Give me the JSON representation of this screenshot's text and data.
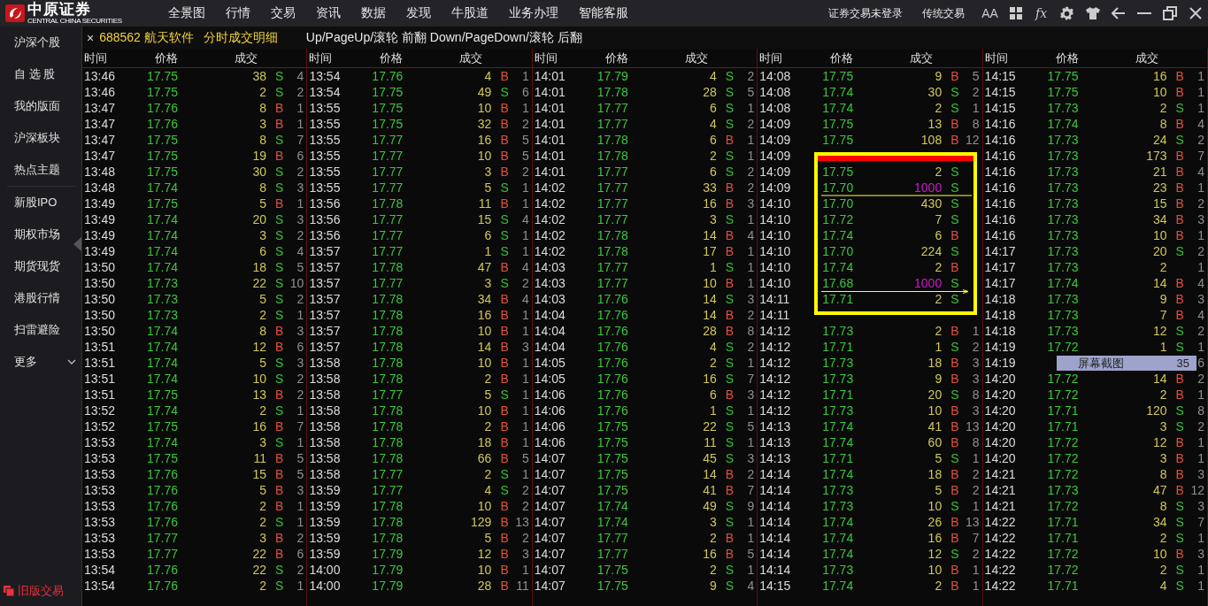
{
  "app": {
    "logo": "中原证券",
    "logo_subtitle": "CENTRAL CHINA SECURITIES",
    "menu": [
      "全景图",
      "行情",
      "交易",
      "资讯",
      "数据",
      "发现",
      "牛股道",
      "业务办理",
      "智能客服"
    ],
    "login_status": "证券交易未登录",
    "classic_trading": "传统交易",
    "font_button": "AA",
    "formula_button": "fx"
  },
  "tab": {
    "close": "×",
    "security": "688562 航天软件",
    "view": "分时成交明细",
    "hint": "Up/PageUp/滚轮 前翻 Down/PageDown/滚轮 后翻"
  },
  "sidebar": {
    "items": [
      "沪深个股",
      "自 选 股",
      "我的版面",
      "沪深板块",
      "热点主题",
      "新股IPO",
      "期权市场",
      "期货现货",
      "港股行情",
      "扫雷避险"
    ],
    "more": "更多",
    "footer": "旧版交易"
  },
  "trades": {
    "columns": [
      {
        "headers": [
          "时间",
          "价格",
          "成交"
        ],
        "rows": [
          {
            "time": "13:46",
            "price": "17.75",
            "volume": "38",
            "side": "S",
            "kind": "sell",
            "large": false,
            "count": "4"
          },
          {
            "time": "13:46",
            "price": "17.75",
            "volume": "2",
            "side": "S",
            "kind": "sell",
            "large": false,
            "count": "2"
          },
          {
            "time": "13:47",
            "price": "17.76",
            "volume": "8",
            "side": "B",
            "kind": "buy",
            "large": false,
            "count": "1"
          },
          {
            "time": "13:47",
            "price": "17.76",
            "volume": "3",
            "side": "B",
            "kind": "buy",
            "large": false,
            "count": "1"
          },
          {
            "time": "13:47",
            "price": "17.75",
            "volume": "8",
            "side": "S",
            "kind": "sell",
            "large": false,
            "count": "7"
          },
          {
            "time": "13:47",
            "price": "17.75",
            "volume": "19",
            "side": "B",
            "kind": "buy",
            "large": false,
            "count": "6"
          },
          {
            "time": "13:48",
            "price": "17.75",
            "volume": "30",
            "side": "S",
            "kind": "sell",
            "large": false,
            "count": "2"
          },
          {
            "time": "13:48",
            "price": "17.74",
            "volume": "8",
            "side": "S",
            "kind": "sell",
            "large": false,
            "count": "3"
          },
          {
            "time": "13:49",
            "price": "17.75",
            "volume": "5",
            "side": "B",
            "kind": "buy",
            "large": false,
            "count": "1"
          },
          {
            "time": "13:49",
            "price": "17.74",
            "volume": "20",
            "side": "S",
            "kind": "sell",
            "large": false,
            "count": "3"
          },
          {
            "time": "13:49",
            "price": "17.74",
            "volume": "3",
            "side": "S",
            "kind": "sell",
            "large": false,
            "count": "2"
          },
          {
            "time": "13:49",
            "price": "17.74",
            "volume": "6",
            "side": "S",
            "kind": "sell",
            "large": false,
            "count": "4"
          },
          {
            "time": "13:50",
            "price": "17.74",
            "volume": "18",
            "side": "S",
            "kind": "sell",
            "large": false,
            "count": "5"
          },
          {
            "time": "13:50",
            "price": "17.73",
            "volume": "22",
            "side": "S",
            "kind": "sell",
            "large": false,
            "count": "10"
          },
          {
            "time": "13:50",
            "price": "17.73",
            "volume": "5",
            "side": "S",
            "kind": "sell",
            "large": false,
            "count": "2"
          },
          {
            "time": "13:50",
            "price": "17.73",
            "volume": "2",
            "side": "S",
            "kind": "sell",
            "large": false,
            "count": "1"
          },
          {
            "time": "13:50",
            "price": "17.74",
            "volume": "8",
            "side": "B",
            "kind": "buy",
            "large": false,
            "count": "3"
          },
          {
            "time": "13:51",
            "price": "17.74",
            "volume": "12",
            "side": "B",
            "kind": "buy",
            "large": false,
            "count": "6"
          },
          {
            "time": "13:51",
            "price": "17.74",
            "volume": "5",
            "side": "S",
            "kind": "sell",
            "large": false,
            "count": "3"
          },
          {
            "time": "13:51",
            "price": "17.74",
            "volume": "10",
            "side": "S",
            "kind": "sell",
            "large": false,
            "count": "2"
          },
          {
            "time": "13:51",
            "price": "17.75",
            "volume": "13",
            "side": "B",
            "kind": "buy",
            "large": false,
            "count": "2"
          },
          {
            "time": "13:52",
            "price": "17.74",
            "volume": "2",
            "side": "S",
            "kind": "sell",
            "large": false,
            "count": "1"
          },
          {
            "time": "13:52",
            "price": "17.75",
            "volume": "16",
            "side": "B",
            "kind": "buy",
            "large": false,
            "count": "7"
          },
          {
            "time": "13:53",
            "price": "17.74",
            "volume": "3",
            "side": "S",
            "kind": "sell",
            "large": false,
            "count": "1"
          },
          {
            "time": "13:53",
            "price": "17.75",
            "volume": "11",
            "side": "B",
            "kind": "buy",
            "large": false,
            "count": "5"
          },
          {
            "time": "13:53",
            "price": "17.76",
            "volume": "15",
            "side": "B",
            "kind": "buy",
            "large": false,
            "count": "5"
          },
          {
            "time": "13:53",
            "price": "17.76",
            "volume": "5",
            "side": "B",
            "kind": "buy",
            "large": false,
            "count": "3"
          },
          {
            "time": "13:53",
            "price": "17.76",
            "volume": "2",
            "side": "B",
            "kind": "buy",
            "large": false,
            "count": "1"
          },
          {
            "time": "13:53",
            "price": "17.76",
            "volume": "2",
            "side": "S",
            "kind": "sell",
            "large": false,
            "count": "1"
          },
          {
            "time": "13:53",
            "price": "17.77",
            "volume": "3",
            "side": "B",
            "kind": "buy",
            "large": false,
            "count": "2"
          },
          {
            "time": "13:53",
            "price": "17.77",
            "volume": "22",
            "side": "B",
            "kind": "buy",
            "large": false,
            "count": "6"
          },
          {
            "time": "13:54",
            "price": "17.76",
            "volume": "22",
            "side": "S",
            "kind": "sell",
            "large": false,
            "count": "2"
          },
          {
            "time": "13:54",
            "price": "17.76",
            "volume": "2",
            "side": "S",
            "kind": "sell",
            "large": false,
            "count": "1"
          }
        ]
      },
      {
        "headers": [
          "时间",
          "价格",
          "成交"
        ],
        "rows": [
          {
            "time": "13:54",
            "price": "17.76",
            "volume": "4",
            "side": "B",
            "kind": "buy",
            "large": false,
            "count": "1"
          },
          {
            "time": "13:54",
            "price": "17.75",
            "volume": "49",
            "side": "S",
            "kind": "sell",
            "large": false,
            "count": "6"
          },
          {
            "time": "13:55",
            "price": "17.75",
            "volume": "10",
            "side": "B",
            "kind": "buy",
            "large": false,
            "count": "1"
          },
          {
            "time": "13:55",
            "price": "17.75",
            "volume": "32",
            "side": "B",
            "kind": "buy",
            "large": false,
            "count": "2"
          },
          {
            "time": "13:55",
            "price": "17.77",
            "volume": "16",
            "side": "B",
            "kind": "buy",
            "large": false,
            "count": "5"
          },
          {
            "time": "13:55",
            "price": "17.77",
            "volume": "10",
            "side": "B",
            "kind": "buy",
            "large": false,
            "count": "5"
          },
          {
            "time": "13:55",
            "price": "17.77",
            "volume": "3",
            "side": "B",
            "kind": "buy",
            "large": false,
            "count": "2"
          },
          {
            "time": "13:55",
            "price": "17.77",
            "volume": "5",
            "side": "S",
            "kind": "sell",
            "large": false,
            "count": "1"
          },
          {
            "time": "13:56",
            "price": "17.78",
            "volume": "11",
            "side": "B",
            "kind": "buy",
            "large": false,
            "count": "1"
          },
          {
            "time": "13:56",
            "price": "17.77",
            "volume": "15",
            "side": "S",
            "kind": "sell",
            "large": false,
            "count": "4"
          },
          {
            "time": "13:56",
            "price": "17.77",
            "volume": "6",
            "side": "S",
            "kind": "sell",
            "large": false,
            "count": "1"
          },
          {
            "time": "13:57",
            "price": "17.77",
            "volume": "1",
            "side": "S",
            "kind": "sell",
            "large": false,
            "count": "1"
          },
          {
            "time": "13:57",
            "price": "17.78",
            "volume": "47",
            "side": "B",
            "kind": "buy",
            "large": false,
            "count": "4"
          },
          {
            "time": "13:57",
            "price": "17.77",
            "volume": "3",
            "side": "S",
            "kind": "sell",
            "large": false,
            "count": "2"
          },
          {
            "time": "13:57",
            "price": "17.78",
            "volume": "34",
            "side": "B",
            "kind": "buy",
            "large": false,
            "count": "4"
          },
          {
            "time": "13:57",
            "price": "17.78",
            "volume": "16",
            "side": "B",
            "kind": "buy",
            "large": false,
            "count": "1"
          },
          {
            "time": "13:57",
            "price": "17.78",
            "volume": "10",
            "side": "B",
            "kind": "buy",
            "large": false,
            "count": "1"
          },
          {
            "time": "13:57",
            "price": "17.78",
            "volume": "14",
            "side": "B",
            "kind": "buy",
            "large": false,
            "count": "3"
          },
          {
            "time": "13:58",
            "price": "17.78",
            "volume": "10",
            "side": "B",
            "kind": "buy",
            "large": false,
            "count": "1"
          },
          {
            "time": "13:58",
            "price": "17.78",
            "volume": "2",
            "side": "B",
            "kind": "buy",
            "large": false,
            "count": "1"
          },
          {
            "time": "13:58",
            "price": "17.77",
            "volume": "5",
            "side": "S",
            "kind": "sell",
            "large": false,
            "count": "1"
          },
          {
            "time": "13:58",
            "price": "17.78",
            "volume": "10",
            "side": "B",
            "kind": "buy",
            "large": false,
            "count": "1"
          },
          {
            "time": "13:58",
            "price": "17.78",
            "volume": "2",
            "side": "B",
            "kind": "buy",
            "large": false,
            "count": "1"
          },
          {
            "time": "13:58",
            "price": "17.78",
            "volume": "18",
            "side": "B",
            "kind": "buy",
            "large": false,
            "count": "1"
          },
          {
            "time": "13:58",
            "price": "17.78",
            "volume": "66",
            "side": "B",
            "kind": "buy",
            "large": false,
            "count": "5"
          },
          {
            "time": "13:58",
            "price": "17.77",
            "volume": "2",
            "side": "S",
            "kind": "sell",
            "large": false,
            "count": "1"
          },
          {
            "time": "13:59",
            "price": "17.77",
            "volume": "4",
            "side": "S",
            "kind": "sell",
            "large": false,
            "count": "2"
          },
          {
            "time": "13:59",
            "price": "17.78",
            "volume": "10",
            "side": "B",
            "kind": "buy",
            "large": false,
            "count": "2"
          },
          {
            "time": "13:59",
            "price": "17.78",
            "volume": "129",
            "side": "B",
            "kind": "buy",
            "large": false,
            "count": "13"
          },
          {
            "time": "13:59",
            "price": "17.78",
            "volume": "5",
            "side": "B",
            "kind": "buy",
            "large": false,
            "count": "2"
          },
          {
            "time": "13:59",
            "price": "17.79",
            "volume": "12",
            "side": "B",
            "kind": "buy",
            "large": false,
            "count": "3"
          },
          {
            "time": "14:00",
            "price": "17.79",
            "volume": "10",
            "side": "B",
            "kind": "buy",
            "large": false,
            "count": "1"
          },
          {
            "time": "14:00",
            "price": "17.79",
            "volume": "28",
            "side": "B",
            "kind": "buy",
            "large": false,
            "count": "11"
          }
        ]
      },
      {
        "headers": [
          "时间",
          "价格",
          "成交"
        ],
        "rows": [
          {
            "time": "14:01",
            "price": "17.79",
            "volume": "4",
            "side": "S",
            "kind": "sell",
            "large": false,
            "count": "2"
          },
          {
            "time": "14:01",
            "price": "17.78",
            "volume": "28",
            "side": "S",
            "kind": "sell",
            "large": false,
            "count": "5"
          },
          {
            "time": "14:01",
            "price": "17.77",
            "volume": "6",
            "side": "S",
            "kind": "sell",
            "large": false,
            "count": "1"
          },
          {
            "time": "14:01",
            "price": "17.77",
            "volume": "4",
            "side": "S",
            "kind": "sell",
            "large": false,
            "count": "2"
          },
          {
            "time": "14:01",
            "price": "17.78",
            "volume": "6",
            "side": "B",
            "kind": "buy",
            "large": false,
            "count": "1"
          },
          {
            "time": "14:01",
            "price": "17.78",
            "volume": "2",
            "side": "S",
            "kind": "sell",
            "large": false,
            "count": "1"
          },
          {
            "time": "14:01",
            "price": "17.77",
            "volume": "6",
            "side": "S",
            "kind": "sell",
            "large": false,
            "count": "2"
          },
          {
            "time": "14:02",
            "price": "17.77",
            "volume": "33",
            "side": "B",
            "kind": "buy",
            "large": false,
            "count": "2"
          },
          {
            "time": "14:02",
            "price": "17.77",
            "volume": "16",
            "side": "B",
            "kind": "buy",
            "large": false,
            "count": "3"
          },
          {
            "time": "14:02",
            "price": "17.77",
            "volume": "3",
            "side": "S",
            "kind": "sell",
            "large": false,
            "count": "1"
          },
          {
            "time": "14:02",
            "price": "17.78",
            "volume": "14",
            "side": "B",
            "kind": "buy",
            "large": false,
            "count": "4"
          },
          {
            "time": "14:02",
            "price": "17.78",
            "volume": "17",
            "side": "B",
            "kind": "buy",
            "large": false,
            "count": "1"
          },
          {
            "time": "14:03",
            "price": "17.77",
            "volume": "1",
            "side": "S",
            "kind": "sell",
            "large": false,
            "count": "1"
          },
          {
            "time": "14:03",
            "price": "17.77",
            "volume": "10",
            "side": "B",
            "kind": "buy",
            "large": false,
            "count": "1"
          },
          {
            "time": "14:03",
            "price": "17.76",
            "volume": "14",
            "side": "S",
            "kind": "sell",
            "large": false,
            "count": "3"
          },
          {
            "time": "14:04",
            "price": "17.76",
            "volume": "14",
            "side": "B",
            "kind": "buy",
            "large": false,
            "count": "2"
          },
          {
            "time": "14:04",
            "price": "17.76",
            "volume": "28",
            "side": "B",
            "kind": "buy",
            "large": false,
            "count": "8"
          },
          {
            "time": "14:04",
            "price": "17.76",
            "volume": "4",
            "side": "S",
            "kind": "sell",
            "large": false,
            "count": "2"
          },
          {
            "time": "14:05",
            "price": "17.76",
            "volume": "2",
            "side": "S",
            "kind": "sell",
            "large": false,
            "count": "1"
          },
          {
            "time": "14:05",
            "price": "17.76",
            "volume": "16",
            "side": "S",
            "kind": "sell",
            "large": false,
            "count": "7"
          },
          {
            "time": "14:06",
            "price": "17.76",
            "volume": "6",
            "side": "B",
            "kind": "buy",
            "large": false,
            "count": "3"
          },
          {
            "time": "14:06",
            "price": "17.76",
            "volume": "1",
            "side": "S",
            "kind": "sell",
            "large": false,
            "count": "1"
          },
          {
            "time": "14:06",
            "price": "17.75",
            "volume": "22",
            "side": "S",
            "kind": "sell",
            "large": false,
            "count": "5"
          },
          {
            "time": "14:06",
            "price": "17.75",
            "volume": "11",
            "side": "S",
            "kind": "sell",
            "large": false,
            "count": "1"
          },
          {
            "time": "14:07",
            "price": "17.75",
            "volume": "45",
            "side": "S",
            "kind": "sell",
            "large": false,
            "count": "3"
          },
          {
            "time": "14:07",
            "price": "17.75",
            "volume": "14",
            "side": "B",
            "kind": "buy",
            "large": false,
            "count": "2"
          },
          {
            "time": "14:07",
            "price": "17.75",
            "volume": "41",
            "side": "B",
            "kind": "buy",
            "large": false,
            "count": "7"
          },
          {
            "time": "14:07",
            "price": "17.74",
            "volume": "49",
            "side": "S",
            "kind": "sell",
            "large": false,
            "count": "9"
          },
          {
            "time": "14:07",
            "price": "17.74",
            "volume": "3",
            "side": "S",
            "kind": "sell",
            "large": false,
            "count": "1"
          },
          {
            "time": "14:07",
            "price": "17.77",
            "volume": "2",
            "side": "B",
            "kind": "buy",
            "large": false,
            "count": "1"
          },
          {
            "time": "14:07",
            "price": "17.77",
            "volume": "16",
            "side": "B",
            "kind": "buy",
            "large": false,
            "count": "5"
          },
          {
            "time": "14:07",
            "price": "17.75",
            "volume": "2",
            "side": "S",
            "kind": "sell",
            "large": false,
            "count": "1"
          },
          {
            "time": "14:07",
            "price": "17.75",
            "volume": "9",
            "side": "S",
            "kind": "sell",
            "large": false,
            "count": "4"
          }
        ]
      },
      {
        "headers": [
          "时间",
          "价格",
          "成交"
        ],
        "rows": [
          {
            "time": "14:08",
            "price": "17.75",
            "volume": "9",
            "side": "B",
            "kind": "buy",
            "large": false,
            "count": "5"
          },
          {
            "time": "14:08",
            "price": "17.74",
            "volume": "30",
            "side": "S",
            "kind": "sell",
            "large": false,
            "count": "2"
          },
          {
            "time": "14:08",
            "price": "17.74",
            "volume": "2",
            "side": "S",
            "kind": "sell",
            "large": false,
            "count": "1"
          },
          {
            "time": "14:09",
            "price": "17.75",
            "volume": "13",
            "side": "B",
            "kind": "buy",
            "large": false,
            "count": "8"
          },
          {
            "time": "14:09",
            "price": "17.75",
            "volume": "108",
            "side": "B",
            "kind": "buy",
            "large": false,
            "count": "12"
          },
          {
            "time": "14:09",
            "kind": "none"
          },
          {
            "time": "14:09",
            "price": "17.75",
            "volume": "2",
            "side": "S",
            "kind": "sell",
            "large": false
          },
          {
            "time": "14:09",
            "price": "17.70",
            "volume": "1000",
            "side": "S",
            "kind": "sell",
            "large": true
          },
          {
            "time": "14:10",
            "price": "17.70",
            "volume": "430",
            "side": "S",
            "kind": "sell",
            "large": false
          },
          {
            "time": "14:10",
            "price": "17.72",
            "volume": "7",
            "side": "S",
            "kind": "sell",
            "large": false
          },
          {
            "time": "14:10",
            "price": "17.74",
            "volume": "6",
            "side": "B",
            "kind": "buy",
            "large": false
          },
          {
            "time": "14:10",
            "price": "17.70",
            "volume": "224",
            "side": "S",
            "kind": "sell",
            "large": false
          },
          {
            "time": "14:10",
            "price": "17.74",
            "volume": "2",
            "side": "B",
            "kind": "buy",
            "large": false
          },
          {
            "time": "14:10",
            "price": "17.68",
            "volume": "1000",
            "side": "S",
            "kind": "sell",
            "large": true
          },
          {
            "time": "14:11",
            "price": "17.71",
            "volume": "2",
            "side": "S",
            "kind": "sell",
            "large": false
          },
          {
            "time": "14:11",
            "kind": "none"
          },
          {
            "time": "14:12",
            "price": "17.73",
            "volume": "2",
            "side": "B",
            "kind": "buy",
            "large": false,
            "count": "1"
          },
          {
            "time": "14:12",
            "price": "17.71",
            "volume": "1",
            "side": "S",
            "kind": "sell",
            "large": false,
            "count": "2"
          },
          {
            "time": "14:12",
            "price": "17.73",
            "volume": "18",
            "side": "B",
            "kind": "buy",
            "large": false,
            "count": "3"
          },
          {
            "time": "14:12",
            "price": "17.73",
            "volume": "9",
            "side": "B",
            "kind": "buy",
            "large": false,
            "count": "3"
          },
          {
            "time": "14:12",
            "price": "17.71",
            "volume": "20",
            "side": "S",
            "kind": "sell",
            "large": false,
            "count": "8"
          },
          {
            "time": "14:12",
            "price": "17.73",
            "volume": "10",
            "side": "B",
            "kind": "buy",
            "large": false,
            "count": "3"
          },
          {
            "time": "14:13",
            "price": "17.74",
            "volume": "41",
            "side": "B",
            "kind": "buy",
            "large": false,
            "count": "13"
          },
          {
            "time": "14:13",
            "price": "17.74",
            "volume": "60",
            "side": "B",
            "kind": "buy",
            "large": false,
            "count": "8"
          },
          {
            "time": "14:13",
            "price": "17.71",
            "volume": "5",
            "side": "S",
            "kind": "sell",
            "large": false,
            "count": "1"
          },
          {
            "time": "14:14",
            "price": "17.74",
            "volume": "18",
            "side": "B",
            "kind": "buy",
            "large": false,
            "count": "2"
          },
          {
            "time": "14:14",
            "price": "17.73",
            "volume": "5",
            "side": "B",
            "kind": "buy",
            "large": false,
            "count": "2"
          },
          {
            "time": "14:14",
            "price": "17.73",
            "volume": "10",
            "side": "S",
            "kind": "sell",
            "large": false,
            "count": "1"
          },
          {
            "time": "14:14",
            "price": "17.74",
            "volume": "26",
            "side": "B",
            "kind": "buy",
            "large": false,
            "count": "13"
          },
          {
            "time": "14:14",
            "price": "17.74",
            "volume": "16",
            "side": "B",
            "kind": "buy",
            "large": false,
            "count": "7"
          },
          {
            "time": "14:14",
            "price": "17.74",
            "volume": "12",
            "side": "S",
            "kind": "sell",
            "large": false,
            "count": "2"
          },
          {
            "time": "14:14",
            "price": "17.73",
            "volume": "10",
            "side": "B",
            "kind": "buy",
            "large": false,
            "count": "1"
          },
          {
            "time": "14:15",
            "price": "17.74",
            "volume": "2",
            "side": "B",
            "kind": "buy",
            "large": false,
            "count": "1"
          }
        ]
      },
      {
        "headers": [
          "时间",
          "价格",
          "成交"
        ],
        "rows": [
          {
            "time": "14:15",
            "price": "17.75",
            "volume": "16",
            "side": "B",
            "kind": "buy",
            "large": false,
            "count": "1"
          },
          {
            "time": "14:15",
            "price": "17.75",
            "volume": "10",
            "side": "B",
            "kind": "buy",
            "large": false,
            "count": "1"
          },
          {
            "time": "14:15",
            "price": "17.73",
            "volume": "2",
            "side": "S",
            "kind": "sell",
            "large": false,
            "count": "1"
          },
          {
            "time": "14:16",
            "price": "17.74",
            "volume": "8",
            "side": "B",
            "kind": "buy",
            "large": false,
            "count": "4"
          },
          {
            "time": "14:16",
            "price": "17.73",
            "volume": "24",
            "side": "S",
            "kind": "sell",
            "large": false,
            "count": "2"
          },
          {
            "time": "14:16",
            "price": "17.73",
            "volume": "173",
            "side": "B",
            "kind": "buy",
            "large": false,
            "count": "7"
          },
          {
            "time": "14:16",
            "price": "17.73",
            "volume": "21",
            "side": "B",
            "kind": "buy",
            "large": false,
            "count": "4"
          },
          {
            "time": "14:16",
            "price": "17.73",
            "volume": "23",
            "side": "B",
            "kind": "buy",
            "large": false,
            "count": "1"
          },
          {
            "time": "14:16",
            "price": "17.73",
            "volume": "15",
            "side": "B",
            "kind": "buy",
            "large": false,
            "count": "2"
          },
          {
            "time": "14:16",
            "price": "17.73",
            "volume": "34",
            "side": "B",
            "kind": "buy",
            "large": false,
            "count": "3"
          },
          {
            "time": "14:16",
            "price": "17.73",
            "volume": "10",
            "side": "B",
            "kind": "buy",
            "large": false,
            "count": "1"
          },
          {
            "time": "14:17",
            "price": "17.73",
            "volume": "20",
            "side": "S",
            "kind": "sell",
            "large": false,
            "count": "2"
          },
          {
            "time": "14:17",
            "price": "17.73",
            "volume": "2",
            "kind": "none",
            "large": false,
            "count": "1"
          },
          {
            "time": "14:17",
            "price": "17.74",
            "volume": "14",
            "side": "B",
            "kind": "buy",
            "large": false,
            "count": "4"
          },
          {
            "time": "14:18",
            "price": "17.73",
            "volume": "9",
            "side": "B",
            "kind": "buy",
            "large": false,
            "count": "3"
          },
          {
            "time": "14:18",
            "price": "17.73",
            "volume": "7",
            "side": "B",
            "kind": "buy",
            "large": false,
            "count": "4"
          },
          {
            "time": "14:18",
            "price": "17.73",
            "volume": "12",
            "side": "S",
            "kind": "sell",
            "large": false,
            "count": "2"
          },
          {
            "time": "14:19",
            "price": "17.72",
            "volume": "1",
            "side": "S",
            "kind": "sell",
            "large": false,
            "count": "1"
          },
          {
            "time": "14:19",
            "kind": "none",
            "count": "6"
          },
          {
            "time": "14:20",
            "price": "17.72",
            "volume": "14",
            "side": "B",
            "kind": "buy",
            "large": false,
            "count": "2"
          },
          {
            "time": "14:20",
            "price": "17.72",
            "volume": "2",
            "side": "B",
            "kind": "buy",
            "large": false,
            "count": "1"
          },
          {
            "time": "14:20",
            "price": "17.71",
            "volume": "120",
            "side": "S",
            "kind": "sell",
            "large": false,
            "count": "8"
          },
          {
            "time": "14:20",
            "price": "17.71",
            "volume": "3",
            "side": "S",
            "kind": "sell",
            "large": false,
            "count": "2"
          },
          {
            "time": "14:20",
            "price": "17.72",
            "volume": "12",
            "side": "B",
            "kind": "buy",
            "large": false,
            "count": "1"
          },
          {
            "time": "14:20",
            "price": "17.72",
            "volume": "3",
            "side": "B",
            "kind": "buy",
            "large": false,
            "count": "1"
          },
          {
            "time": "14:21",
            "price": "17.72",
            "volume": "8",
            "side": "B",
            "kind": "buy",
            "large": false,
            "count": "3"
          },
          {
            "time": "14:21",
            "price": "17.73",
            "volume": "47",
            "side": "B",
            "kind": "buy",
            "large": false,
            "count": "12"
          },
          {
            "time": "14:21",
            "price": "17.72",
            "volume": "8",
            "side": "S",
            "kind": "sell",
            "large": false,
            "count": "3"
          },
          {
            "time": "14:22",
            "price": "17.71",
            "volume": "34",
            "side": "S",
            "kind": "sell",
            "large": false,
            "count": "7"
          },
          {
            "time": "14:22",
            "price": "17.71",
            "volume": "2",
            "side": "S",
            "kind": "sell",
            "large": false,
            "count": "1"
          },
          {
            "time": "14:22",
            "price": "17.72",
            "volume": "10",
            "side": "B",
            "kind": "buy",
            "large": false,
            "count": "3"
          },
          {
            "time": "14:22",
            "price": "17.72",
            "volume": "2",
            "side": "S",
            "kind": "sell",
            "large": false,
            "count": "1"
          },
          {
            "time": "14:22",
            "price": "17.71",
            "volume": "4",
            "side": "S",
            "kind": "sell",
            "large": false,
            "count": "1"
          }
        ]
      }
    ]
  },
  "tooltip": {
    "label": "屏幕截图",
    "value": "35"
  }
}
